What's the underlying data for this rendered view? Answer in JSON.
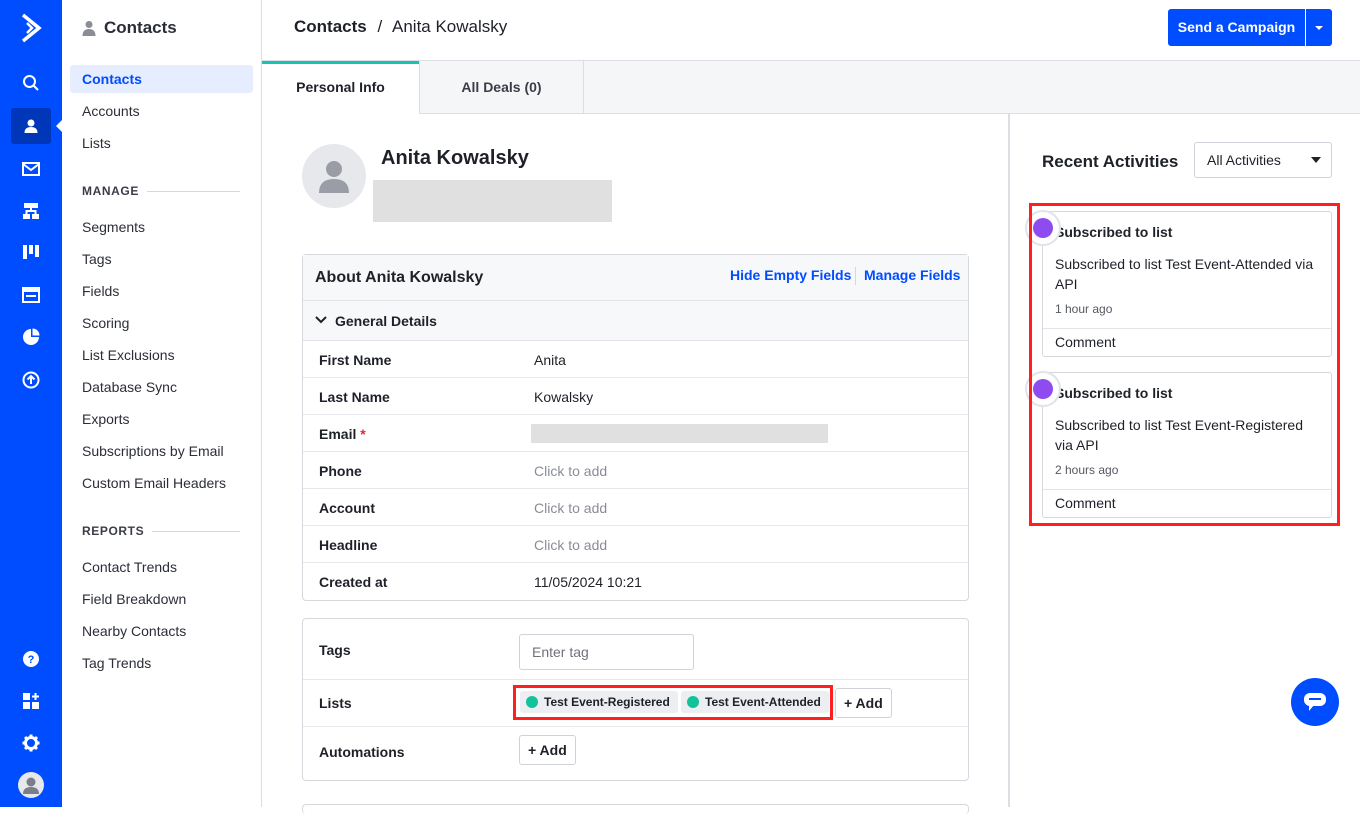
{
  "sidebar": {
    "title": "Contacts",
    "items": [
      {
        "label": "Contacts"
      },
      {
        "label": "Accounts"
      },
      {
        "label": "Lists"
      }
    ],
    "manage_header": "MANAGE",
    "manage_items": [
      {
        "label": "Segments"
      },
      {
        "label": "Tags"
      },
      {
        "label": "Fields"
      },
      {
        "label": "Scoring"
      },
      {
        "label": "List Exclusions"
      },
      {
        "label": "Database Sync"
      },
      {
        "label": "Exports"
      },
      {
        "label": "Subscriptions by Email"
      },
      {
        "label": "Custom Email Headers"
      }
    ],
    "reports_header": "REPORTS",
    "reports_items": [
      {
        "label": "Contact Trends"
      },
      {
        "label": "Field Breakdown"
      },
      {
        "label": "Nearby Contacts"
      },
      {
        "label": "Tag Trends"
      }
    ]
  },
  "header": {
    "crumb_root": "Contacts",
    "crumb_sep": "/",
    "crumb_current": "Anita Kowalsky",
    "campaign_button": "Send a Campaign"
  },
  "tabs": [
    {
      "label": "Personal Info"
    },
    {
      "label": "All Deals (0)"
    }
  ],
  "profile": {
    "name": "Anita Kowalsky"
  },
  "about": {
    "title": "About Anita Kowalsky",
    "hide_empty": "Hide Empty Fields",
    "manage_fields": "Manage Fields",
    "section": "General Details",
    "fields": [
      {
        "key": "First Name",
        "value": "Anita"
      },
      {
        "key": "Last Name",
        "value": "Kowalsky"
      },
      {
        "key": "Email",
        "value": ""
      },
      {
        "key": "Phone",
        "value": "Click to add"
      },
      {
        "key": "Account",
        "value": "Click to add"
      },
      {
        "key": "Headline",
        "value": "Click to add"
      },
      {
        "key": "Created at",
        "value": "11/05/2024 10:21"
      }
    ],
    "required_mark": "*"
  },
  "relations": {
    "tags_label": "Tags",
    "tag_placeholder": "Enter tag",
    "lists_label": "Lists",
    "lists": [
      {
        "name": "Test Event-Registered"
      },
      {
        "name": "Test Event-Attended"
      }
    ],
    "add_label": "+ Add",
    "automations_label": "Automations"
  },
  "activities": {
    "title": "Recent Activities",
    "filter": "All Activities",
    "items": [
      {
        "heading": "Subscribed to list",
        "body": "Subscribed to list Test Event-Attended via API",
        "time": "1 hour ago",
        "comment": "Comment"
      },
      {
        "heading": "Subscribed to list",
        "body": "Subscribed to list Test Event-Registered via API",
        "time": "2 hours ago",
        "comment": "Comment"
      }
    ]
  },
  "colors": {
    "brand": "#004cff",
    "highlight": "#ff1f1f",
    "tab_accent": "#17c3b2",
    "list_check": "#13c29a",
    "activity_icon": "#8e4cf0"
  }
}
